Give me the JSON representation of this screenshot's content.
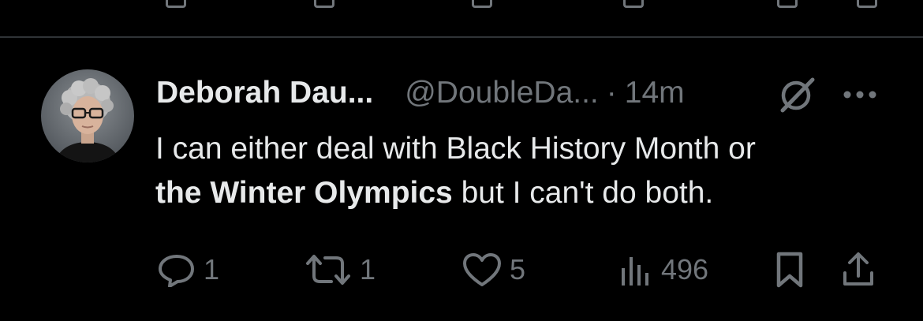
{
  "tweet": {
    "display_name": "Deborah Dau...",
    "handle": "@DoubleDa...",
    "separator": "·",
    "time": "14m",
    "text_line1": "I can either deal with Black History Month or",
    "text_bold": "the Winter Olympics",
    "text_rest": " but I can't do both."
  },
  "actions": {
    "replies": "1",
    "reposts": "1",
    "likes": "5",
    "views": "496"
  },
  "colors": {
    "background": "#000000",
    "primary_text": "#e7e9ea",
    "secondary_text": "#71767b",
    "divider": "#2f3336"
  },
  "icons": {
    "grok": "grok-icon",
    "more": "more-icon",
    "reply": "reply-icon",
    "repost": "repost-icon",
    "like": "heart-icon",
    "views": "views-icon",
    "bookmark": "bookmark-icon",
    "share": "share-icon"
  }
}
